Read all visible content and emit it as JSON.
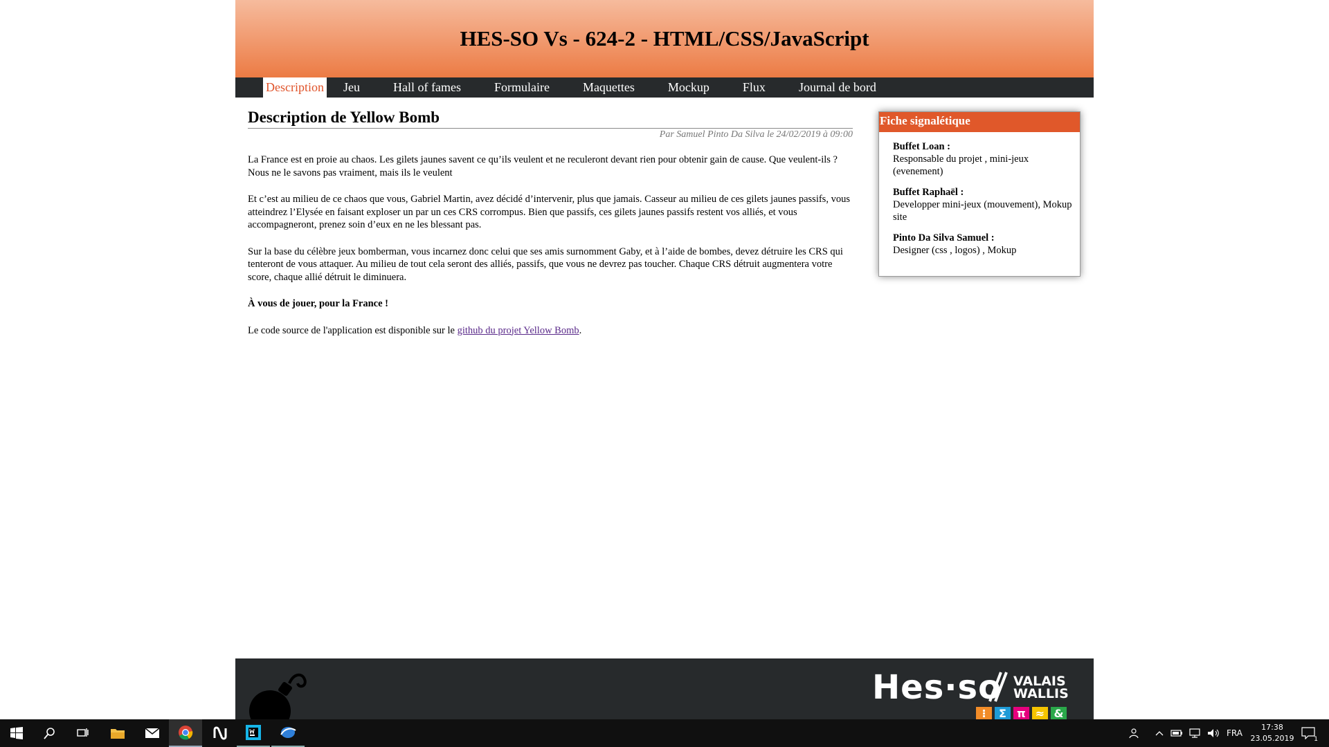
{
  "header": {
    "title": "HES-SO Vs - 624-2 - HTML/CSS/JavaScript"
  },
  "nav": {
    "items": [
      {
        "label": "Description",
        "active": true
      },
      {
        "label": "Jeu"
      },
      {
        "label": "Hall of fames"
      },
      {
        "label": "Formulaire"
      },
      {
        "label": "Maquettes"
      },
      {
        "label": "Mockup"
      },
      {
        "label": "Flux"
      },
      {
        "label": "Journal de bord"
      }
    ]
  },
  "article": {
    "title": "Description de Yellow Bomb",
    "byline": "Par Samuel Pinto Da Silva le 24/02/2019 à 09:00",
    "paragraphs": [
      "La France est en proie au chaos. Les gilets jaunes savent ce qu’ils veulent et ne reculeront devant rien pour obtenir gain de cause. Que veulent-ils ? Nous ne le savons pas vraiment, mais ils le veulent",
      "Et c’est au milieu de ce chaos que vous, Gabriel Martin, avez décidé d’intervenir, plus que jamais. Casseur au milieu de ces gilets jaunes passifs, vous atteindrez l’Elysée en faisant exploser un par un ces CRS corrompus. Bien que passifs, ces gilets jaunes passifs restent vos alliés, et vous accompagneront, prenez soin d’eux en ne les blessant pas.",
      "Sur la base du célèbre jeux bomberman, vous incarnez donc celui que ses amis surnomment Gaby, et à l’aide de bombes, devez détruire les CRS qui tenteront de vous attaquer. Au milieu de tout cela seront des alliés, passifs, que vous ne devrez pas toucher. Chaque CRS détruit augmentera votre score, chaque allié détruit le diminuera."
    ],
    "call_to_action": "À vous de jouer, pour la France !",
    "source_prefix": "Le code source de l'application est disponible sur le ",
    "source_link": "github du projet Yellow Bomb",
    "source_suffix": "."
  },
  "factsheet": {
    "title": "Fiche signalétique",
    "entries": [
      {
        "name": "Buffet Loan :",
        "role": "Responsable du projet , mini-jeux (evenement)"
      },
      {
        "name": "Buffet Raphaël :",
        "role": "Developper mini-jeux (mouvement), Mokup site"
      },
      {
        "name": "Pinto Da Silva Samuel :",
        "role": "Designer (css , logos) , Mokup"
      }
    ]
  },
  "footer": {
    "logo_text": "Hes·so",
    "logo_sub_1": "VALAIS",
    "logo_sub_2": "WALLIS",
    "tiles": [
      {
        "glyph": "⁝",
        "color": "#f28c28"
      },
      {
        "glyph": "Σ",
        "color": "#1e9bd7"
      },
      {
        "glyph": "π",
        "color": "#e6007e"
      },
      {
        "glyph": "≈",
        "color": "#f6c500"
      },
      {
        "glyph": "&",
        "color": "#2aa84a"
      }
    ]
  },
  "taskbar": {
    "language": "FRA",
    "time": "17:38",
    "date": "23.05.2019",
    "notification_count": "1",
    "apps": [
      "windows-start-icon",
      "search-icon",
      "task-view-icon",
      "file-explorer-icon",
      "mail-icon",
      "chrome-icon",
      "notion-icon",
      "webstorm-icon",
      "browser-icon"
    ]
  }
}
